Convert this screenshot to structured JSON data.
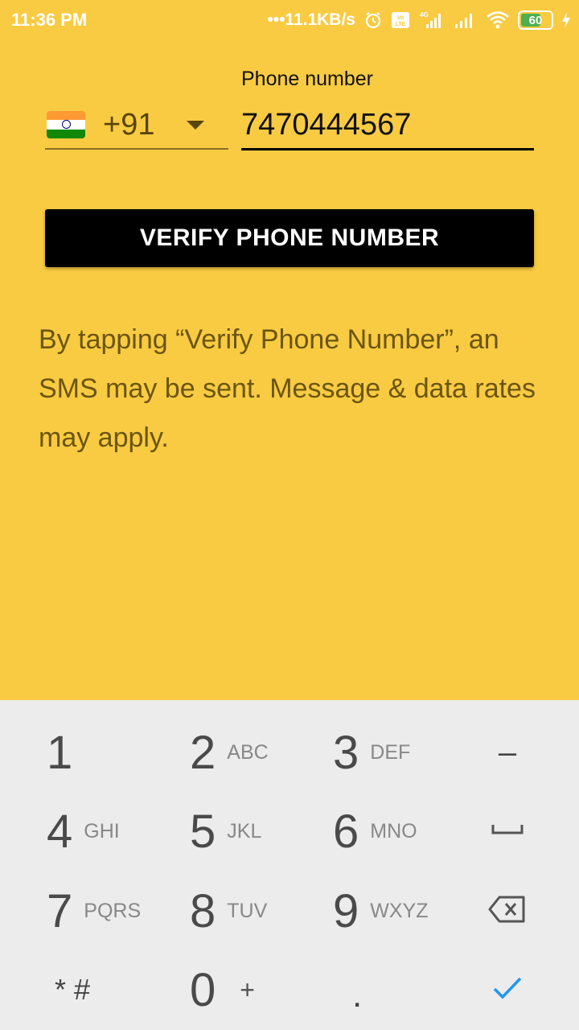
{
  "status_bar": {
    "time": "11:36 PM",
    "net_speed": "•••11.1KB/s",
    "battery_level": "60",
    "icons": [
      "alarm-icon",
      "volte-icon",
      "signal-4g-icon",
      "signal-icon",
      "wifi-icon",
      "battery-icon",
      "charging-icon"
    ]
  },
  "form": {
    "phone_label": "Phone number",
    "country_code": "+91",
    "country_flag": "india-flag-icon",
    "phone_value": "7470444567"
  },
  "verify_button_label": "VERIFY PHONE NUMBER",
  "disclaimer": "By tapping “Verify Phone Number”, an SMS may be sent. Message & data rates may apply.",
  "keypad": {
    "keys": [
      {
        "digit": "1",
        "letters": ""
      },
      {
        "digit": "2",
        "letters": "ABC"
      },
      {
        "digit": "3",
        "letters": "DEF"
      },
      {
        "digit": "4",
        "letters": "GHI"
      },
      {
        "digit": "5",
        "letters": "JKL"
      },
      {
        "digit": "6",
        "letters": "MNO"
      },
      {
        "digit": "7",
        "letters": "PQRS"
      },
      {
        "digit": "8",
        "letters": "TUV"
      },
      {
        "digit": "9",
        "letters": "WXYZ"
      },
      {
        "digit": "0",
        "letters": "+"
      }
    ],
    "star_hash": "* #",
    "dot": ".",
    "minus": "–"
  },
  "colors": {
    "background": "#F9CB42",
    "button": "#000000",
    "keypad_bg": "#ECECEC",
    "accent_check": "#2196F3"
  }
}
